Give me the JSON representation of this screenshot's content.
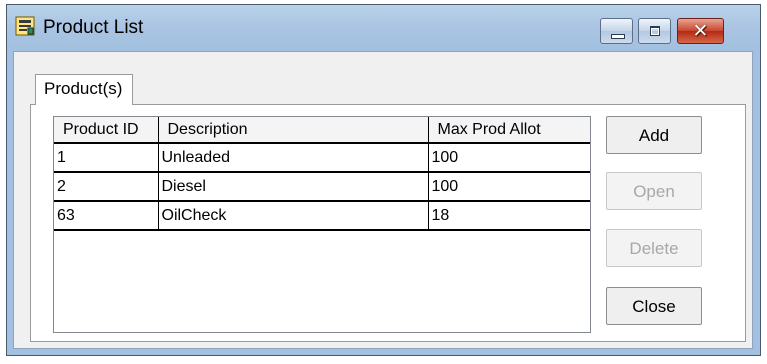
{
  "window": {
    "title": "Product List",
    "icon": "document-icon",
    "controls": {
      "minimize": "minimize-icon",
      "maximize": "maximize-icon",
      "close": "✕"
    }
  },
  "tab": {
    "label": "Product(s)"
  },
  "table": {
    "headers": [
      "Product ID",
      "Description",
      "Max Prod Allot"
    ],
    "rows": [
      [
        "1",
        "Unleaded",
        "100"
      ],
      [
        "2",
        "Diesel",
        "100"
      ],
      [
        "63",
        "OilCheck",
        "18"
      ]
    ]
  },
  "buttons": {
    "add": "Add",
    "open": "Open",
    "delete": "Delete",
    "close": "Close"
  },
  "colors": {
    "titlebar": "#b9d1ea",
    "close_button": "#c9452f",
    "disabled_text": "#a8a8a8"
  }
}
